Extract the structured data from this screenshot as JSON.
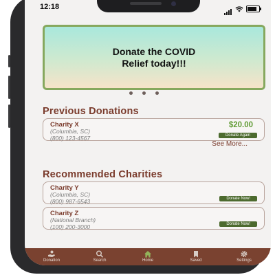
{
  "status": {
    "time": "12:18"
  },
  "banner": {
    "text": "Donate the COVID\nRelief today!!!"
  },
  "carousel": {
    "pages": 3
  },
  "previous": {
    "title": "Previous Donations",
    "card": {
      "name": "Charity X",
      "location": "(Columbia, SC)",
      "phone": "(800) 123-4567",
      "amount": "$20.00",
      "button": "Donate Again"
    },
    "see_more": "See More..."
  },
  "recommended": {
    "title": "Recommended Charities",
    "cards": [
      {
        "name": "Charity Y",
        "location": "(Columbia, SC)",
        "phone": "(800) 987-6543",
        "button": "Donate Now!"
      },
      {
        "name": "Charity Z",
        "location": "(National Branch)",
        "phone": "(100) 200-3000",
        "button": "Donate Now!"
      }
    ]
  },
  "tabs": [
    {
      "label": "Donation",
      "icon": "donation-icon"
    },
    {
      "label": "Search",
      "icon": "search-icon"
    },
    {
      "label": "Home",
      "icon": "home-icon",
      "active": true
    },
    {
      "label": "Saved",
      "icon": "bookmark-icon"
    },
    {
      "label": "Settings",
      "icon": "gear-icon"
    }
  ],
  "colors": {
    "accent": "#7a3b2c",
    "tabbar": "#7a4230",
    "button": "#4c6a2e",
    "amount": "#5f9a33",
    "banner_border": "#86a85e",
    "home_icon": "#93b45b"
  }
}
